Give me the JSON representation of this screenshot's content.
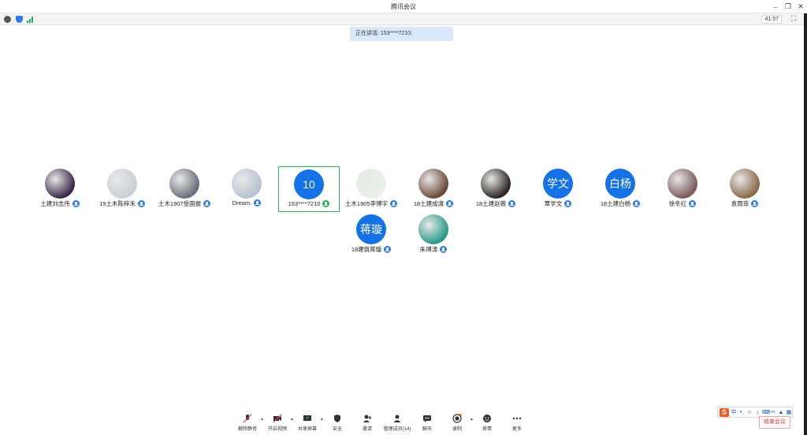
{
  "window": {
    "title": "腾讯会议",
    "timer": "41:57"
  },
  "speaking_banner": "正在讲话: 153****7210;",
  "participants": [
    {
      "name": "土建刘志伟",
      "avatar": "photo",
      "avatar_color": "#3b2a4a"
    },
    {
      "name": "19土木陈梓禾",
      "avatar": "photo",
      "avatar_color": "#c9cfd6"
    },
    {
      "name": "土木1907受国振",
      "avatar": "photo",
      "avatar_color": "#6a6f7a"
    },
    {
      "name": "Dream.",
      "avatar": "photo",
      "avatar_color": "#b7c3cf"
    },
    {
      "name": "153****7210",
      "avatar": "text",
      "avatar_text": "10"
    },
    {
      "name": "土木1905李博宇",
      "avatar": "photo",
      "avatar_color": "#e8f2e6"
    },
    {
      "name": "18土建成潇",
      "avatar": "photo",
      "avatar_color": "#6b4a3a"
    },
    {
      "name": "18土建赵薇",
      "avatar": "photo",
      "avatar_color": "#2b2624"
    },
    {
      "name": "覃学文",
      "avatar": "text",
      "avatar_text": "学文"
    },
    {
      "name": "18土建白杨",
      "avatar": "text",
      "avatar_text": "白杨"
    },
    {
      "name": "徐冬红",
      "avatar": "photo",
      "avatar_color": "#7a5a5c"
    },
    {
      "name": "袁雨菲",
      "avatar": "photo",
      "avatar_color": "#8a6a4a"
    },
    {
      "name": "18建筑蒋璇",
      "avatar": "text",
      "avatar_text": "蒋璇"
    },
    {
      "name": "朱博涛",
      "avatar": "photo",
      "avatar_color": "#2a9a8a"
    }
  ],
  "toolbar": {
    "unmute": "解除静音",
    "start_video": "开启视频",
    "share_screen": "共享屏幕",
    "security": "安全",
    "invite": "邀请",
    "members": "管理成员(14)",
    "chat": "聊天",
    "record": "录制",
    "reactions": "表情",
    "more": "更多"
  },
  "end_meeting": "结束会议",
  "ime": {
    "mode": "中"
  },
  "colors": {
    "accent": "#1472e6",
    "active_border": "#2bb05c",
    "banner": "#d9e9fb"
  }
}
